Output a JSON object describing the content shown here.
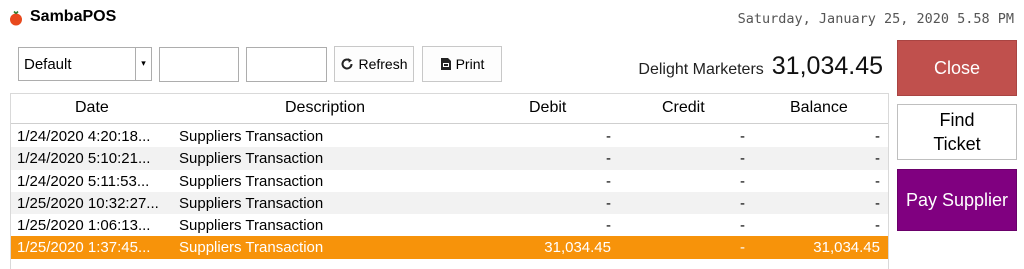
{
  "app": {
    "title": "SambaPOS",
    "datetime": "Saturday, January 25, 2020 5.58 PM"
  },
  "toolbar": {
    "filter_value": "Default",
    "refresh_label": "Refresh",
    "print_label": "Print"
  },
  "account": {
    "name": "Delight Marketers",
    "balance": "31,034.45"
  },
  "table": {
    "headers": {
      "date": "Date",
      "description": "Description",
      "debit": "Debit",
      "credit": "Credit",
      "balance": "Balance"
    },
    "rows": [
      {
        "date": "1/24/2020 4:20:18...",
        "description": "Suppliers Transaction",
        "debit": "-",
        "credit": "-",
        "balance": "-"
      },
      {
        "date": "1/24/2020 5:10:21...",
        "description": "Suppliers Transaction",
        "debit": "-",
        "credit": "-",
        "balance": "-"
      },
      {
        "date": "1/24/2020 5:11:53...",
        "description": "Suppliers Transaction",
        "debit": "-",
        "credit": "-",
        "balance": "-"
      },
      {
        "date": "1/25/2020 10:32:27...",
        "description": "Suppliers Transaction",
        "debit": "-",
        "credit": "-",
        "balance": "-"
      },
      {
        "date": "1/25/2020 1:06:13...",
        "description": "Suppliers Transaction",
        "debit": "-",
        "credit": "-",
        "balance": "-"
      },
      {
        "date": "1/25/2020 1:37:45...",
        "description": "Suppliers Transaction",
        "debit": "31,034.45",
        "credit": "-",
        "balance": "31,034.45"
      }
    ],
    "selected_row": 5
  },
  "side": {
    "close_label": "Close",
    "find_ticket_label": "Find\nTicket",
    "pay_supplier_label": "Pay Supplier"
  },
  "colors": {
    "selected_row": "#f7930a",
    "close_button": "#c0504d",
    "pay_button": "#800080"
  },
  "icons": {
    "logo": "tomato-logo-icon",
    "refresh": "refresh-icon",
    "print": "print-icon",
    "dropdown": "chevron-down-icon"
  }
}
